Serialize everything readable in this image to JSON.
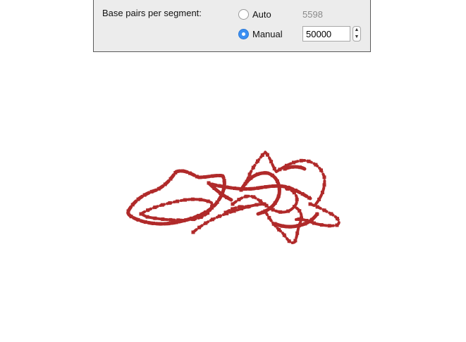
{
  "segment_panel": {
    "label": "Base pairs per segment:",
    "auto_label": "Auto",
    "auto_value": "5598",
    "manual_label": "Manual",
    "manual_value": "50000",
    "selected": "manual"
  },
  "viewer": {
    "strand_color": "#b02a2a"
  }
}
